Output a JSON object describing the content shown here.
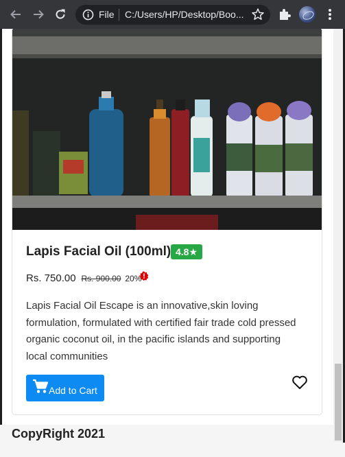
{
  "browser": {
    "site_chip": "File",
    "url": "C:/Users/HP/Desktop/Boo..."
  },
  "product": {
    "image_description_icon": "product-photo",
    "title": "Lapis Facial Oil (100ml)",
    "rating": "4.8★",
    "price_current": "Rs. 750.00",
    "price_original": "Rs. 900.00",
    "discount": "20%",
    "description": "Lapis Facial Oil Escape is an innovative,skin loving formulation, formulated with certified fair trade cold pressed organic coconut oil, in the pacific islands and supporting local communities",
    "add_to_cart_label": "Add to Cart"
  },
  "footer": {
    "text": "CopyRight 2021"
  },
  "colors": {
    "rating_badge": "#28a745",
    "button": "#0d8bf2",
    "browser_toolbar": "#35363a"
  }
}
